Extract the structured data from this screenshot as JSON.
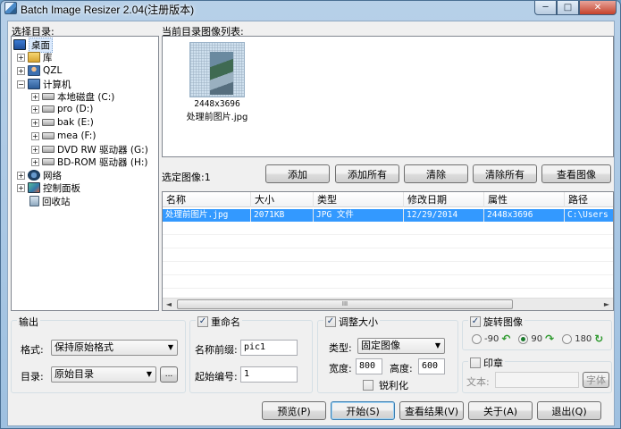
{
  "window": {
    "title": "Batch Image Resizer 2.04(注册版本)"
  },
  "titlebar_buttons": {
    "minimize": "─",
    "maximize": "□",
    "close": "✕"
  },
  "labels": {
    "select_dir": "选择目录:",
    "image_list": "当前目录图像列表:",
    "selected_count": "选定图像:1"
  },
  "tree": {
    "desktop": "桌面",
    "library": "库",
    "user": "QZL",
    "computer": "计算机",
    "drive_c": "本地磁盘 (C:)",
    "drive_d": "pro (D:)",
    "drive_e": "bak (E:)",
    "drive_f": "mea (F:)",
    "drive_g": "DVD RW 驱动器 (G:)",
    "drive_h": "BD-ROM 驱动器 (H:)",
    "network": "网络",
    "control_panel": "控制面板",
    "recycle_bin": "回收站"
  },
  "thumbnail": {
    "dimensions": "2448x3696",
    "name": "处理前图片.jpg"
  },
  "toolbar": {
    "add": "添加",
    "add_all": "添加所有",
    "clear": "清除",
    "clear_all": "清除所有",
    "view_image": "查看图像"
  },
  "file_list": {
    "columns": [
      "名称",
      "大小",
      "类型",
      "修改日期",
      "属性",
      "路径"
    ],
    "rows": [
      {
        "name": "处理前图片.jpg",
        "size": "2071KB",
        "type": "JPG 文件",
        "date": "12/29/2014",
        "attrs": "2448x3696",
        "path": "C:\\Users"
      }
    ],
    "scroll_thumb": "III",
    "scroll_left": "◄",
    "scroll_right": "►"
  },
  "output": {
    "title": "输出",
    "format_label": "格式:",
    "format_value": "保持原始格式",
    "dir_label": "目录:",
    "dir_value": "原始目录",
    "browse": "..."
  },
  "rename": {
    "title": "重命名",
    "prefix_label": "名称前缀:",
    "prefix_value": "pic1",
    "start_label": "起始编号:",
    "start_value": "1"
  },
  "resize": {
    "title": "调整大小",
    "type_label": "类型:",
    "type_value": "固定图像",
    "width_label": "宽度:",
    "width_value": "800",
    "height_label": "高度:",
    "height_value": "600",
    "sharpen": "锐利化"
  },
  "rotate": {
    "title": "旋转图像",
    "opt1": "-90",
    "opt2": "90",
    "opt3": "180"
  },
  "watermark": {
    "title": "印章",
    "text_label": "文本:",
    "font_button": "字体"
  },
  "bottom": {
    "preview": "预览(P)",
    "start": "开始(S)",
    "view_results": "查看结果(V)",
    "about": "关于(A)",
    "exit": "退出(Q)"
  },
  "colors": {
    "selection": "#3399ff",
    "titlebar": "#b7d0e8",
    "close": "#c5422c"
  }
}
